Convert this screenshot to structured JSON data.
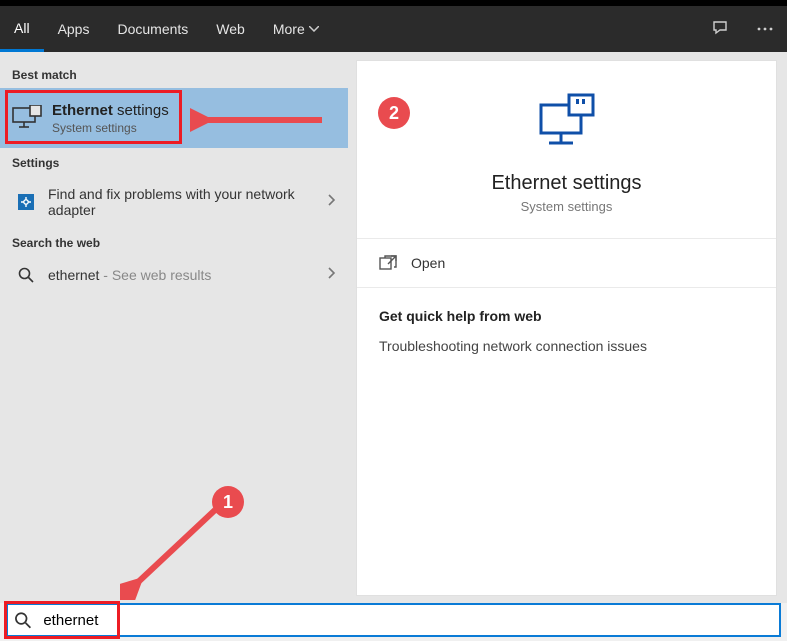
{
  "tabs": {
    "all": "All",
    "apps": "Apps",
    "documents": "Documents",
    "web": "Web",
    "more": "More"
  },
  "search": {
    "value": "ethernet"
  },
  "left": {
    "best_match_label": "Best match",
    "settings_label": "Settings",
    "search_web_label": "Search the web",
    "best_match": {
      "title_bold": "Ethernet",
      "title_rest": " settings",
      "subtitle": "System settings"
    },
    "troubleshoot": {
      "text": "Find and fix problems with your network adapter"
    },
    "web_result": {
      "term": "ethernet",
      "suffix": " - See web results"
    }
  },
  "preview": {
    "title": "Ethernet settings",
    "subtitle": "System settings",
    "open": "Open",
    "help_header": "Get quick help from web",
    "help_line": "Troubleshooting network connection issues"
  },
  "annotations": {
    "badge1": "1",
    "badge2": "2"
  }
}
